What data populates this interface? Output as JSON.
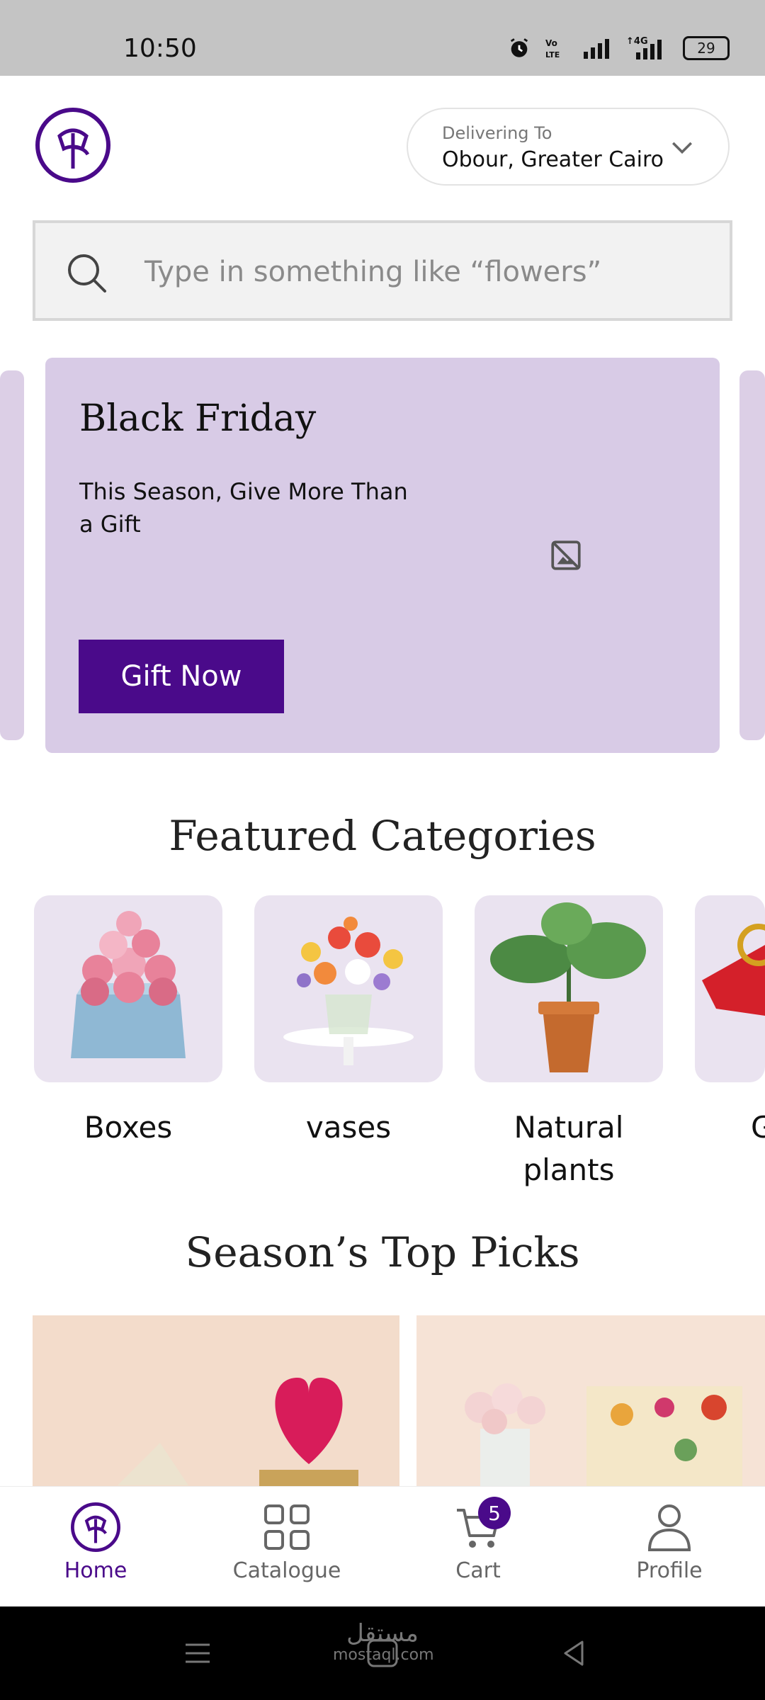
{
  "status_bar": {
    "time": "10:50",
    "battery": "29"
  },
  "header": {
    "delivering_label": "Delivering To",
    "delivering_value": "Obour, Greater Cairo"
  },
  "search": {
    "placeholder": "Type in something like “flowers”"
  },
  "banner": {
    "title": "Black Friday",
    "subtitle": "This Season, Give More Than a Gift",
    "button": "Gift Now"
  },
  "featured": {
    "title": "Featured Categories",
    "items": [
      {
        "label": "Boxes"
      },
      {
        "label": "vases"
      },
      {
        "label": "Natural plants"
      },
      {
        "label": "G"
      }
    ]
  },
  "top_picks": {
    "title": "Season’s Top Picks"
  },
  "nav": {
    "items": [
      {
        "label": "Home"
      },
      {
        "label": "Catalogue"
      },
      {
        "label": "Cart"
      },
      {
        "label": "Profile"
      }
    ],
    "cart_count": "5"
  },
  "watermark": {
    "line1": "مستقل",
    "line2": "mostaql.com"
  },
  "colors": {
    "brand": "#4a0a8a",
    "banner_bg": "#d8cbe6",
    "card_bg": "#eae3f0"
  }
}
